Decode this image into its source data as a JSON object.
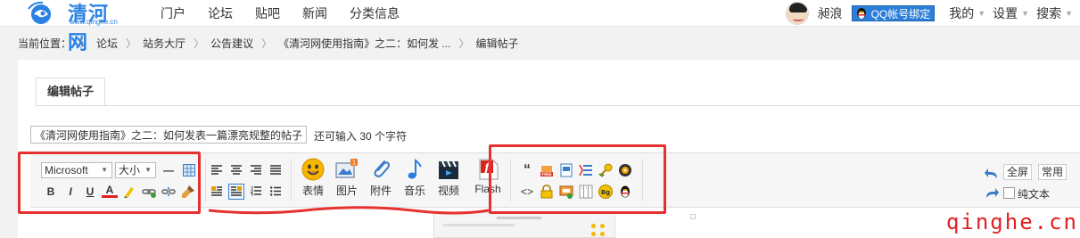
{
  "brand": {
    "name": "清河网",
    "domain": "www.qinghe.cn",
    "accent": "#2a82e4"
  },
  "nav": {
    "items": [
      "门户",
      "论坛",
      "贴吧",
      "新闻",
      "分类信息"
    ]
  },
  "user": {
    "name": "昶浪",
    "qq_bind": "QQ帐号绑定"
  },
  "top_menu": {
    "mine": "我的",
    "settings": "设置",
    "search": "搜索"
  },
  "breadcrumb": {
    "label": "当前位置：",
    "items": [
      "论坛",
      "站务大厅",
      "公告建议",
      "《清河网使用指南》之二：如何发 ...",
      "编辑帖子"
    ]
  },
  "editor": {
    "tab": "编辑帖子",
    "title_value": "《清河网使用指南》之二：如何发表一篇漂亮规整的帖子",
    "title_hint": "还可输入 30 个字符",
    "font_select": "Microsoft",
    "size_select": "大小",
    "format_buttons": [
      "B",
      "I",
      "U",
      "A"
    ],
    "insert_labels": {
      "emoji": "表情",
      "image": "图片",
      "attach": "附件",
      "music": "音乐",
      "video": "视频",
      "flash": "Flash"
    },
    "fullscreen": "全屏",
    "common": "常用",
    "plain_text": "纯文本"
  },
  "watermark": "qinghe.cn",
  "colors": {
    "highlight_box": "#e5312f",
    "qq_button": "#2c7fd8"
  }
}
